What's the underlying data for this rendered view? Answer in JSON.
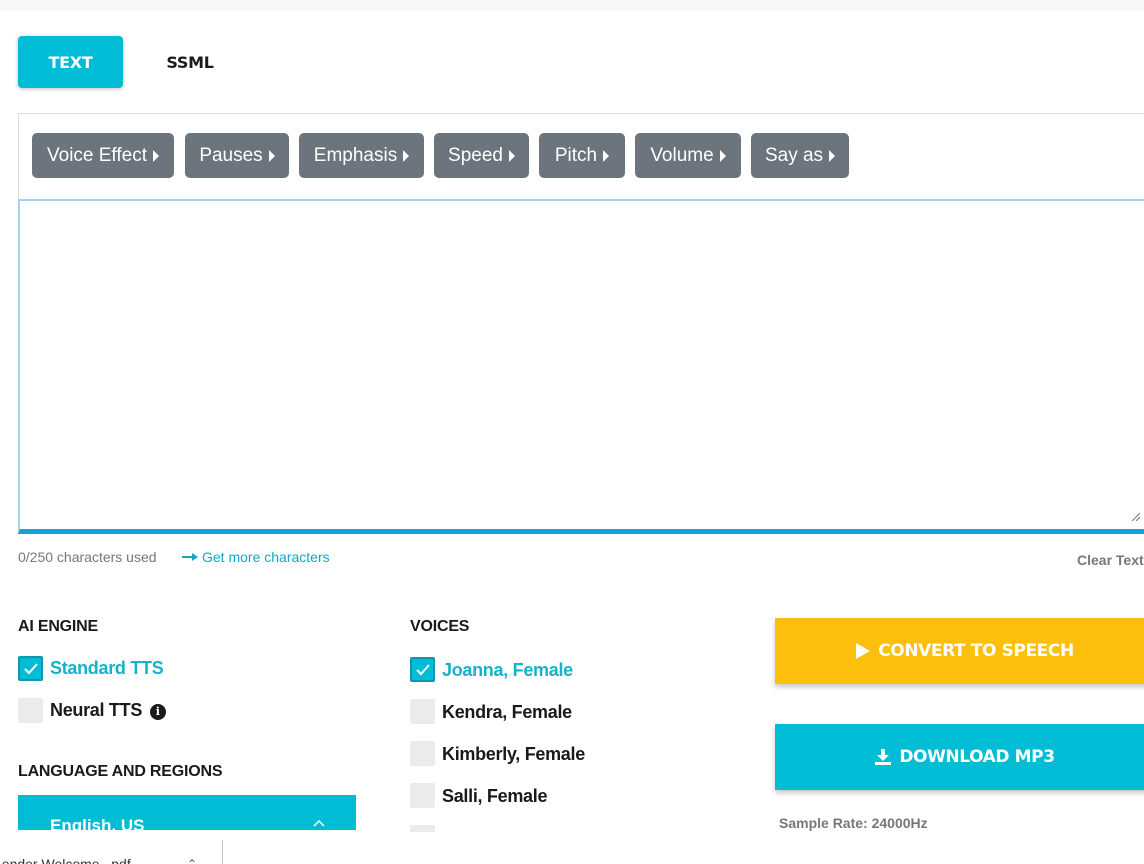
{
  "tabs": [
    {
      "label": "TEXT",
      "active": true
    },
    {
      "label": "SSML",
      "active": false
    }
  ],
  "toolbar": {
    "buttons": [
      "Voice Effect",
      "Pauses",
      "Emphasis",
      "Speed",
      "Pitch",
      "Volume",
      "Say as"
    ]
  },
  "editor": {
    "value": ""
  },
  "counter": {
    "used": "0/250 characters used",
    "more_link": "Get more characters",
    "clear": "Clear Text"
  },
  "engine": {
    "heading": "AI ENGINE",
    "options": [
      {
        "label": "Standard TTS",
        "checked": true
      },
      {
        "label": "Neural TTS",
        "checked": false
      }
    ]
  },
  "voices": {
    "heading": "VOICES",
    "options": [
      {
        "label": "Joanna, Female",
        "checked": true
      },
      {
        "label": "Kendra, Female",
        "checked": false
      },
      {
        "label": "Kimberly, Female",
        "checked": false
      },
      {
        "label": "Salli, Female",
        "checked": false
      }
    ]
  },
  "language": {
    "heading": "LANGUAGE AND REGIONS",
    "selected": "English, US"
  },
  "actions": {
    "convert": "CONVERT TO SPEECH",
    "download": "DOWNLOAD MP3",
    "sample_rate": "Sample Rate: 24000Hz"
  },
  "downloads_bar": {
    "file": "Lender Welcome...pdf"
  },
  "colors": {
    "accent": "#00bcd4",
    "convert": "#fbbf0c",
    "toolbar_button": "#6c757d"
  }
}
